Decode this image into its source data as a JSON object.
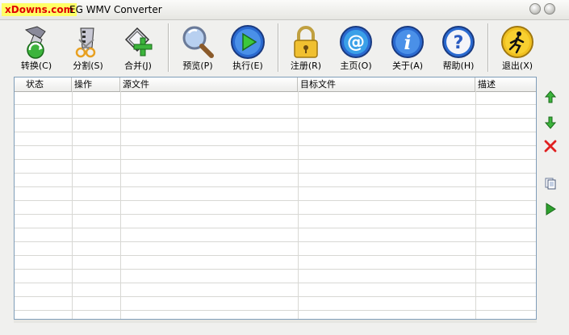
{
  "window": {
    "watermark": "xDowns.com",
    "title": "EG WMV Converter"
  },
  "toolbar": {
    "convert": "转换(C)",
    "split": "分割(S)",
    "merge": "合并(J)",
    "preview": "预览(P)",
    "execute": "执行(E)",
    "register": "注册(R)",
    "homepage": "主页(O)",
    "about": "关于(A)",
    "help": "帮助(H)",
    "exit": "退出(X)"
  },
  "table": {
    "columns": [
      "状态",
      "操作",
      "源文件",
      "目标文件",
      "描述"
    ],
    "rows": []
  },
  "colors": {
    "title_bg": "#e6e6e2",
    "watermark_bg": "#ffff66",
    "watermark_fg": "#e00000",
    "arrow_green": "#2e9b2e",
    "delete_red": "#e02020"
  }
}
